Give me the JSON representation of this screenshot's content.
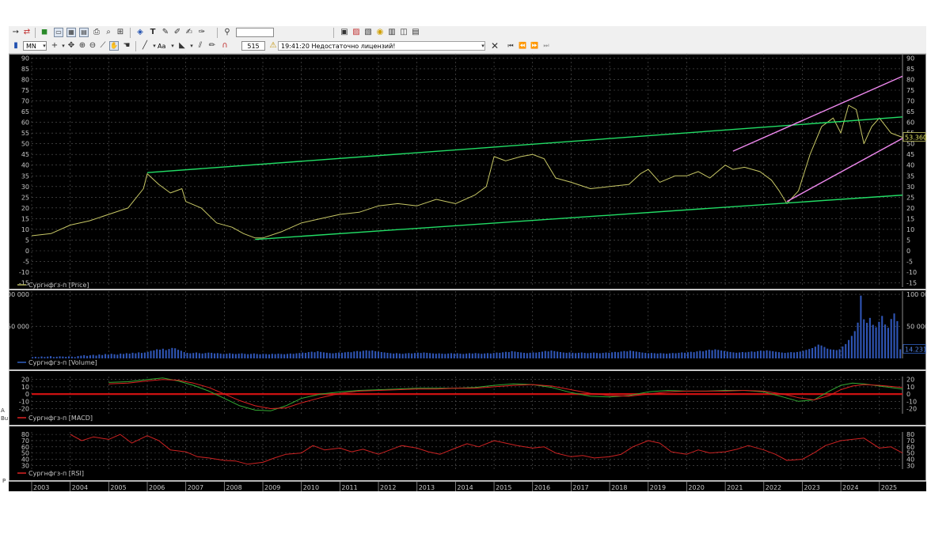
{
  "toolbar": {
    "search_value": "",
    "timeframe": "MN",
    "font_label": "Aa",
    "bar_count": "515",
    "status_message": "19:41:20 Недостаточно лицензий!",
    "icons": [
      "arrow-right-icon",
      "new-chart-icon",
      "green-square-icon",
      "window-icon",
      "grid-icon",
      "chart-icon",
      "print-icon",
      "zoom-icon",
      "price-icon",
      "text-icon",
      "tool-icon",
      "zoom-in-icon",
      "zoom-out-icon",
      "search-icon",
      "book-icon",
      "info-icon",
      "save-icon",
      "folder-icon",
      "database-icon",
      "export-icon"
    ]
  },
  "panels": {
    "price_label": "Сургнфгз-п [Price]",
    "volume_label": "Сургнфгз-п [Volume]",
    "macd_label": "Сургнфгз-п [MACD]",
    "rsi_label": "Сургнфгз-п [RSI]"
  },
  "left_fragments": [
    "A",
    "Bu",
    "P"
  ],
  "chart_data": [
    {
      "type": "line",
      "name": "Price",
      "y_ticks": [
        90,
        85,
        80,
        75,
        70,
        65,
        60,
        55,
        50,
        45,
        40,
        35,
        30,
        25,
        20,
        15,
        10,
        5,
        0,
        -5,
        -10,
        -15
      ],
      "ylim": [
        -17,
        92
      ],
      "last_value": "53.360",
      "x": [
        2003.0,
        2003.5,
        2004.0,
        2004.5,
        2005.0,
        2005.5,
        2005.9,
        2006.0,
        2006.3,
        2006.6,
        2006.9,
        2007.0,
        2007.4,
        2007.8,
        2008.2,
        2008.5,
        2008.8,
        2009.0,
        2009.5,
        2010.0,
        2010.5,
        2011.0,
        2011.5,
        2012.0,
        2012.5,
        2013.0,
        2013.5,
        2014.0,
        2014.5,
        2014.8,
        2015.0,
        2015.3,
        2015.7,
        2016.0,
        2016.3,
        2016.6,
        2017.0,
        2017.5,
        2018.0,
        2018.5,
        2018.8,
        2019.0,
        2019.3,
        2019.7,
        2020.0,
        2020.3,
        2020.6,
        2021.0,
        2021.2,
        2021.5,
        2021.9,
        2022.2,
        2022.4,
        2022.6,
        2022.9,
        2023.2,
        2023.5,
        2023.8,
        2024.0,
        2024.2,
        2024.4,
        2024.6,
        2024.8,
        2025.0,
        2025.3,
        2025.6
      ],
      "y": [
        7,
        8,
        12,
        14,
        17,
        20,
        29,
        36,
        31,
        27,
        29,
        23,
        20,
        13,
        11,
        8,
        6,
        6,
        9,
        13,
        15,
        17,
        18,
        21,
        22,
        21,
        24,
        22,
        26,
        30,
        44,
        42,
        44,
        45,
        43,
        34,
        32,
        29,
        30,
        31,
        36,
        38,
        32,
        35,
        35,
        37,
        34,
        40,
        38,
        39,
        37,
        33,
        28,
        22,
        28,
        45,
        58,
        62,
        55,
        68,
        66,
        50,
        58,
        62,
        55,
        53
      ],
      "trendlines": [
        {
          "color": "#22dd66",
          "points": [
            [
              2006.0,
              36.5
            ],
            [
              2025.6,
              62.5
            ]
          ]
        },
        {
          "color": "#22dd66",
          "points": [
            [
              2008.8,
              5.3
            ],
            [
              2025.6,
              26.0
            ]
          ]
        },
        {
          "color": "#ee88ee",
          "points": [
            [
              2021.2,
              46.5
            ],
            [
              2025.6,
              81.5
            ]
          ]
        },
        {
          "color": "#ee88ee",
          "points": [
            [
              2022.6,
              23.0
            ],
            [
              2025.6,
              52.5
            ]
          ]
        }
      ]
    },
    {
      "type": "bar",
      "name": "Volume",
      "y_ticks": [
        100000,
        50000
      ],
      "ylim": [
        0,
        105000
      ],
      "last_value": "14.231",
      "x_start": 2003.0,
      "x_end": 2025.6,
      "values": [
        2000,
        2500,
        1800,
        3000,
        2200,
        2800,
        3500,
        2100,
        2600,
        3200,
        2900,
        2400,
        3100,
        2700,
        2000,
        3600,
        4200,
        5100,
        3900,
        4800,
        5600,
        4400,
        6100,
        5200,
        6800,
        5900,
        7200,
        6400,
        5800,
        7500,
        6900,
        8100,
        7400,
        8800,
        7900,
        9400,
        8500,
        9100,
        10200,
        11800,
        12500,
        14200,
        13600,
        15100,
        12900,
        14600,
        16300,
        15800,
        13400,
        11900,
        9800,
        8600,
        7900,
        8400,
        9200,
        8100,
        7600,
        8300,
        9000,
        8700,
        7800,
        8200,
        7500,
        6900,
        7300,
        8000,
        7200,
        6800,
        7400,
        7900,
        7100,
        6600,
        7000,
        7700,
        6900,
        6400,
        7100,
        6800,
        6300,
        7200,
        6700,
        7400,
        6900,
        6500,
        7000,
        7600,
        7100,
        7900,
        8400,
        9100,
        8600,
        9800,
        10400,
        9600,
        11200,
        10100,
        9400,
        8800,
        8200,
        7900,
        8500,
        9200,
        8800,
        9500,
        10100,
        9600,
        10800,
        11500,
        10700,
        11900,
        12600,
        11800,
        12400,
        11200,
        10600,
        9900,
        9300,
        8700,
        8100,
        7500,
        8200,
        7600,
        7100,
        7800,
        8300,
        7700,
        8400,
        9000,
        8500,
        9200,
        8700,
        8200,
        7800,
        7300,
        7900,
        7400,
        7000,
        7600,
        8100,
        7500,
        8000,
        7400,
        6900,
        7500,
        8100,
        7600,
        8300,
        7800,
        7200,
        7700,
        8200,
        7600,
        8400,
        9100,
        8700,
        9500,
        10200,
        9800,
        11300,
        10600,
        9900,
        9300,
        8700,
        8200,
        8800,
        9400,
        9000,
        9800,
        10500,
        11600,
        10900,
        12300,
        11400,
        10600,
        9900,
        9200,
        8700,
        9300,
        8800,
        8200,
        8700,
        9200,
        8600,
        8100,
        8600,
        9100,
        8500,
        8000,
        8600,
        9200,
        8800,
        9500,
        10100,
        9600,
        10700,
        11500,
        10900,
        12100,
        11300,
        10600,
        9800,
        9100,
        8600,
        8000,
        8500,
        8100,
        7600,
        8200,
        7800,
        7300,
        7900,
        8400,
        8000,
        8700,
        9300,
        8800,
        9600,
        10300,
        9700,
        10900,
        11800,
        11000,
        12400,
        13600,
        12800,
        14100,
        13200,
        12300,
        11500,
        10700,
        10000,
        9400,
        8800,
        9300,
        9900,
        9400,
        10100,
        10800,
        10200,
        11300,
        12100,
        11400,
        12600,
        11800,
        11100,
        10400,
        9700,
        9100,
        8600,
        9200,
        9800,
        9300,
        10000,
        10700,
        11800,
        13200,
        14600,
        16100,
        18300,
        21500,
        20100,
        17800,
        15200,
        14100,
        13600,
        12900,
        14200,
        18600,
        22400,
        28700,
        35100,
        42600,
        55800,
        98000,
        61000,
        55500,
        63200,
        52400,
        48600,
        57100,
        66300,
        52900,
        47800,
        61500,
        70100,
        58200,
        14231
      ]
    },
    {
      "type": "line",
      "name": "MACD",
      "y_ticks": [
        20,
        10,
        0,
        -10,
        -20
      ],
      "ylim": [
        -27,
        24
      ],
      "x": [
        2005.0,
        2005.5,
        2006.0,
        2006.4,
        2006.8,
        2007.2,
        2007.6,
        2008.0,
        2008.4,
        2008.8,
        2009.2,
        2009.6,
        2010.0,
        2010.5,
        2011.0,
        2011.5,
        2012.0,
        2012.5,
        2013.0,
        2013.5,
        2014.0,
        2014.5,
        2015.0,
        2015.5,
        2016.0,
        2016.5,
        2017.0,
        2017.5,
        2018.0,
        2018.5,
        2019.0,
        2019.5,
        2020.0,
        2020.5,
        2021.0,
        2021.5,
        2022.0,
        2022.5,
        2022.9,
        2023.3,
        2023.7,
        2024.0,
        2024.3,
        2024.6,
        2025.0,
        2025.6
      ],
      "series": [
        {
          "color": "#33aa33",
          "values": [
            16,
            17,
            20,
            22,
            18,
            12,
            4,
            -6,
            -16,
            -22,
            -23,
            -16,
            -6,
            0,
            3,
            5,
            6,
            7,
            8,
            8,
            8,
            9,
            12,
            14,
            13,
            9,
            2,
            -3,
            -4,
            -2,
            3,
            5,
            4,
            4,
            5,
            5,
            3,
            -4,
            -10,
            -8,
            4,
            12,
            15,
            14,
            11,
            7
          ]
        },
        {
          "color": "#dd2222",
          "values": [
            14,
            15,
            18,
            20,
            19,
            15,
            9,
            0,
            -9,
            -16,
            -20,
            -19,
            -12,
            -5,
            1,
            4,
            5,
            6,
            7,
            7,
            8,
            8,
            10,
            12,
            13,
            11,
            6,
            1,
            -2,
            -3,
            0,
            3,
            4,
            4,
            4,
            5,
            4,
            0,
            -5,
            -8,
            -2,
            6,
            11,
            13,
            12,
            9
          ]
        }
      ],
      "zero_line_color": "#cc1111"
    },
    {
      "type": "line",
      "name": "RSI",
      "y_ticks": [
        80,
        70,
        60,
        50,
        40,
        30
      ],
      "ylim": [
        24,
        84
      ],
      "x": [
        2004.0,
        2004.3,
        2004.6,
        2005.0,
        2005.3,
        2005.6,
        2006.0,
        2006.3,
        2006.6,
        2007.0,
        2007.3,
        2007.6,
        2008.0,
        2008.3,
        2008.6,
        2009.0,
        2009.3,
        2009.6,
        2010.0,
        2010.3,
        2010.6,
        2011.0,
        2011.3,
        2011.6,
        2012.0,
        2012.3,
        2012.6,
        2013.0,
        2013.3,
        2013.6,
        2014.0,
        2014.3,
        2014.6,
        2015.0,
        2015.3,
        2015.6,
        2016.0,
        2016.3,
        2016.6,
        2017.0,
        2017.3,
        2017.6,
        2018.0,
        2018.3,
        2018.6,
        2019.0,
        2019.3,
        2019.6,
        2020.0,
        2020.3,
        2020.6,
        2021.0,
        2021.3,
        2021.6,
        2022.0,
        2022.3,
        2022.6,
        2023.0,
        2023.3,
        2023.6,
        2024.0,
        2024.3,
        2024.6,
        2025.0,
        2025.3,
        2025.6
      ],
      "values": [
        80,
        70,
        76,
        72,
        80,
        66,
        78,
        70,
        55,
        52,
        44,
        42,
        38,
        37,
        32,
        35,
        42,
        48,
        50,
        62,
        55,
        58,
        52,
        56,
        48,
        55,
        62,
        58,
        52,
        48,
        58,
        65,
        60,
        70,
        66,
        62,
        58,
        60,
        50,
        44,
        46,
        42,
        44,
        48,
        60,
        70,
        66,
        52,
        48,
        55,
        50,
        52,
        56,
        62,
        55,
        48,
        38,
        40,
        50,
        62,
        70,
        72,
        74,
        58,
        60,
        50
      ]
    }
  ],
  "x_axis_years": [
    "2003",
    "2004",
    "2005",
    "2006",
    "2007",
    "2008",
    "2009",
    "2010",
    "2011",
    "2012",
    "2013",
    "2014",
    "2015",
    "2016",
    "2017",
    "2018",
    "2019",
    "2020",
    "2021",
    "2022",
    "2023",
    "2024",
    "2025"
  ]
}
